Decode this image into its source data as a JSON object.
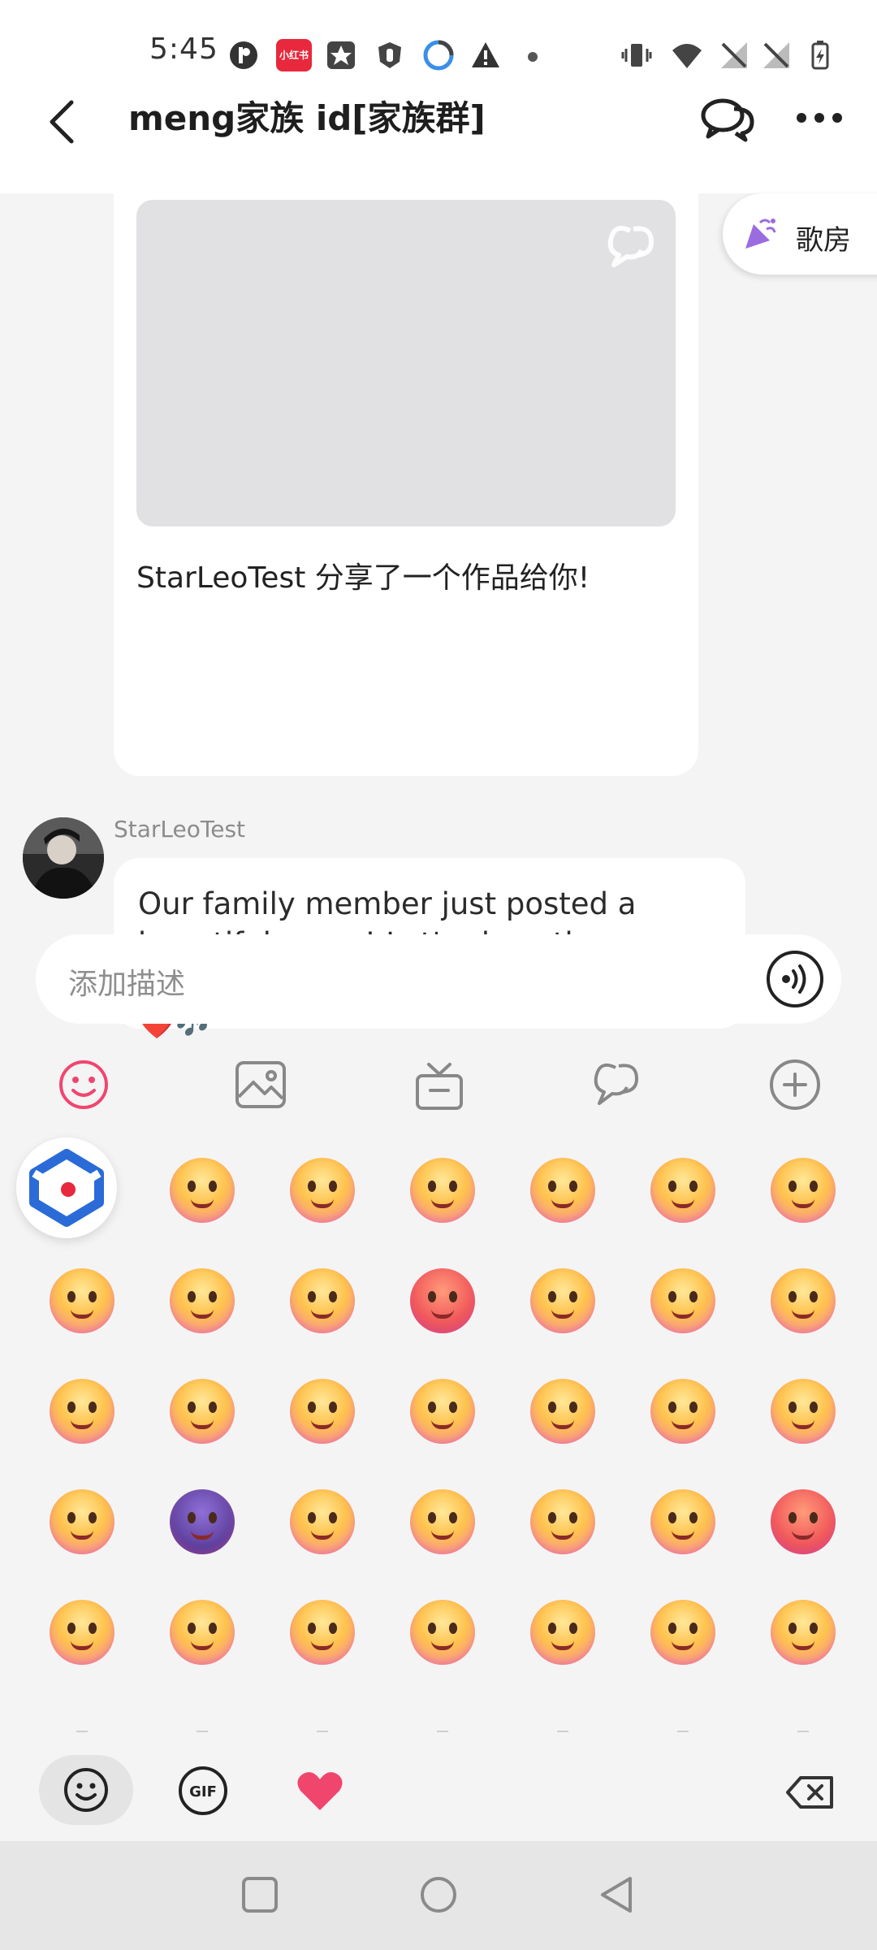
{
  "status_bar": {
    "time": "5:45",
    "app_badge": "小红书",
    "icons": [
      "app-p-icon",
      "xiaohongshu-icon",
      "star-app-icon",
      "shield-app-icon",
      "browser-icon",
      "warning-icon",
      "dot-icon",
      "vibrate-icon",
      "wifi-icon",
      "signal-off-icon",
      "signal-off-icon",
      "battery-icon"
    ]
  },
  "header": {
    "title": "meng家族 id[家族群]",
    "icons": [
      "back-arrow-icon",
      "chat-bubbles-icon",
      "more-dots-icon"
    ]
  },
  "room_button": {
    "label": "歌房",
    "icon": "party-popper-icon"
  },
  "share_card": {
    "caption": "StarLeoTest 分享了一个作品给你!",
    "preview_icon": "app-logo-watermark-icon"
  },
  "message": {
    "sender": "StarLeoTest",
    "text": "Our family member just posted a beautiful cover! Let's show them some love by liking and commenting! ❤️🎶"
  },
  "input": {
    "placeholder": "添加描述",
    "voice_icon": "voice-wave-icon"
  },
  "toolbar": {
    "items": [
      "emoji-icon",
      "image-icon",
      "gift-icon",
      "app-logo-icon",
      "plus-icon"
    ]
  },
  "emoji_panel": {
    "rows": 5,
    "columns": 7,
    "emojis": [
      "grin",
      "grinning-teeth",
      "sly-grin",
      "smirk-sweat",
      "slipper-hit",
      "pleading",
      "shocked",
      "rainbow-vomit",
      "facepalm-cry",
      "nervous-laugh",
      "angry",
      "confused",
      "eye-roll",
      "laugh-cry",
      "teary",
      "smoking",
      "blush-laugh",
      "scream",
      "hand-face-cry",
      "fists-angry",
      "star-hit",
      "praying",
      "bomb",
      "egg-head",
      "shush",
      "hand-cover",
      "green-vomit",
      "furious",
      "dizzy",
      "kiss-heart",
      "crying",
      "love-hearts",
      "rolling-laugh",
      "taped-mouth",
      "wink"
    ]
  },
  "bottom_bar": {
    "tabs": [
      "smiley-tab-icon",
      "gif-tab-icon",
      "heart-tab-icon"
    ],
    "gif_label": "GIF",
    "delete_icon": "backspace-icon"
  },
  "colors": {
    "accent_pink": "#f0466e",
    "background": "#f4f4f5",
    "bubble": "#ffffff",
    "badge_blue": "#2a6bd8"
  },
  "nav_bar": {
    "buttons": [
      "recent-apps-icon",
      "home-icon",
      "back-triangle-icon"
    ]
  }
}
